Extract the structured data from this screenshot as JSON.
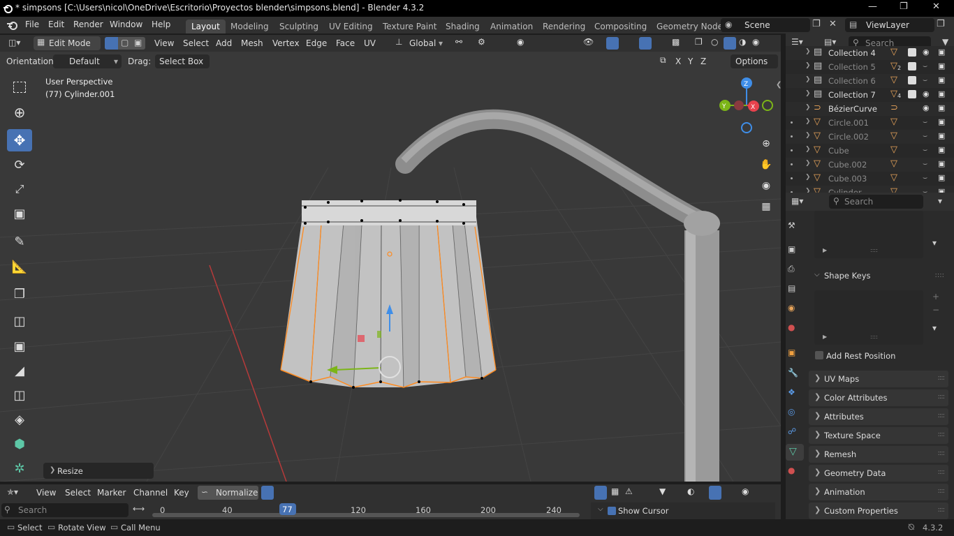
{
  "titlebar": {
    "title": "* simpsons [C:\\Users\\nicol\\OneDrive\\Escritorio\\Proyectos blender\\simpsons.blend] - Blender 4.3.2"
  },
  "menu": [
    "File",
    "Edit",
    "Render",
    "Window",
    "Help"
  ],
  "workspaces": [
    "Layout",
    "Modeling",
    "Sculpting",
    "UV Editing",
    "Texture Paint",
    "Shading",
    "Animation",
    "Rendering",
    "Compositing",
    "Geometry Node"
  ],
  "active_workspace": "Layout",
  "scene": "Scene",
  "view_layer": "ViewLayer",
  "viewport_header": {
    "mode": "Edit Mode",
    "menus": [
      "View",
      "Select",
      "Add",
      "Mesh",
      "Vertex",
      "Edge",
      "Face",
      "UV"
    ],
    "transform_orientation": "Global",
    "orientation_label": "Orientation:",
    "orientation_value": "Default",
    "drag_label": "Drag:",
    "drag_value": "Select Box",
    "options_label": "Options",
    "axis_x": "X",
    "axis_y": "Y",
    "axis_z": "Z"
  },
  "viewport": {
    "perspective": "User Perspective",
    "object": "(77) Cylinder.001",
    "last_op": "Resize",
    "gizmo": {
      "x": "X",
      "y": "Y",
      "z": "Z"
    }
  },
  "outliner": {
    "search_placeholder": "Search",
    "items": [
      {
        "name": "Collection 4",
        "kind": "collection",
        "badge": ""
      },
      {
        "name": "Collection 5",
        "kind": "collection",
        "badge": "2"
      },
      {
        "name": "Collection 6",
        "kind": "collection",
        "badge": ""
      },
      {
        "name": "Collection 7",
        "kind": "collection",
        "badge": "4"
      },
      {
        "name": "BézierCurve",
        "kind": "curve",
        "badge": ""
      },
      {
        "name": "Circle.001",
        "kind": "mesh",
        "badge": ""
      },
      {
        "name": "Circle.002",
        "kind": "mesh",
        "badge": ""
      },
      {
        "name": "Cube",
        "kind": "mesh",
        "badge": ""
      },
      {
        "name": "Cube.002",
        "kind": "mesh",
        "badge": ""
      },
      {
        "name": "Cube.003",
        "kind": "mesh",
        "badge": ""
      },
      {
        "name": "Cylinder",
        "kind": "mesh",
        "badge": ""
      }
    ]
  },
  "properties": {
    "search_placeholder": "Search",
    "shape_keys_label": "Shape Keys",
    "add_rest_position": "Add Rest Position",
    "panels": [
      "UV Maps",
      "Color Attributes",
      "Attributes",
      "Texture Space",
      "Remesh",
      "Geometry Data",
      "Animation",
      "Custom Properties"
    ]
  },
  "timeline": {
    "menus": [
      "View",
      "Select",
      "Marker",
      "Channel",
      "Key"
    ],
    "normalize": "Normalize",
    "search_placeholder": "Search",
    "current_frame": "77",
    "ticks": [
      "0",
      "40",
      "120",
      "160",
      "200",
      "240"
    ],
    "show_cursor": "Show Cursor"
  },
  "statusbar": {
    "select": "Select",
    "rotate_view": "Rotate View",
    "call_menu": "Call Menu",
    "version": "4.3.2"
  },
  "colors": {
    "accent": "#4772b3",
    "selection": "#ff8a1e",
    "x_axis": "#e8424d",
    "y_axis": "#7cb518",
    "z_axis": "#3f8ee8"
  }
}
